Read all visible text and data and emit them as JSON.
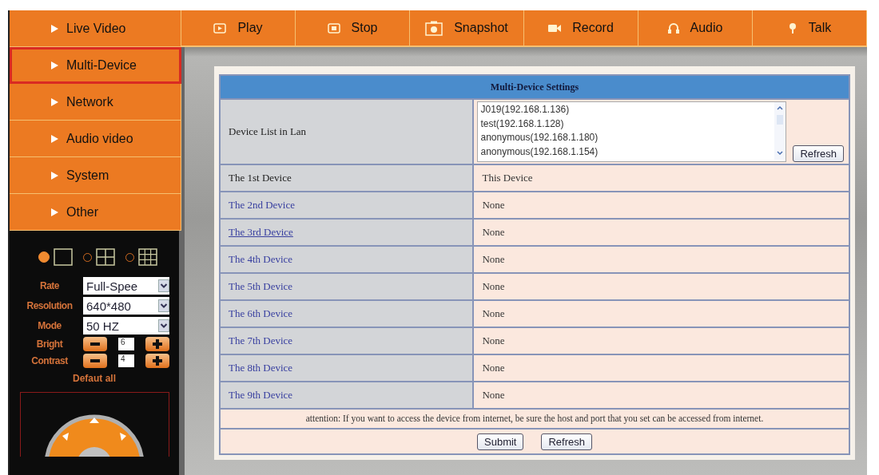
{
  "menu": [
    {
      "label": "Live Video",
      "selected": false
    },
    {
      "label": "Multi-Device",
      "selected": true
    },
    {
      "label": "Network",
      "selected": false
    },
    {
      "label": "Audio video",
      "selected": false
    },
    {
      "label": "System",
      "selected": false
    },
    {
      "label": "Other",
      "selected": false
    }
  ],
  "toolbar": [
    {
      "label": "Play",
      "kind": "play"
    },
    {
      "label": "Stop",
      "kind": "stop"
    },
    {
      "label": "Snapshot",
      "kind": "camera"
    },
    {
      "label": "Record",
      "kind": "video"
    },
    {
      "label": "Audio",
      "kind": "headphones"
    },
    {
      "label": "Talk",
      "kind": "mic"
    }
  ],
  "view_modes": [
    {
      "kind": "single",
      "selected": true
    },
    {
      "kind": "quad",
      "selected": false
    },
    {
      "kind": "nine",
      "selected": false
    }
  ],
  "settings": [
    {
      "kind": "select",
      "label": "Rate",
      "value": "Full-Spee"
    },
    {
      "kind": "select",
      "label": "Resolution",
      "value": "640*480"
    },
    {
      "kind": "select",
      "label": "Mode",
      "value": "50 HZ"
    },
    {
      "kind": "stepper",
      "label": "Bright",
      "value": "6"
    },
    {
      "kind": "stepper",
      "label": "Contrast",
      "value": "4"
    }
  ],
  "default_all": "Defaut all",
  "panel": {
    "title": "Multi-Device Settings",
    "device_list_label": "Device List in Lan",
    "device_list": [
      "J019(192.168.1.136)",
      "test(192.168.1.128)",
      "anonymous(192.168.1.180)",
      "anonymous(192.168.1.154)"
    ],
    "list_refresh": "Refresh",
    "devices": [
      {
        "name": "The 1st Device",
        "value": "This Device",
        "link": false,
        "underlined": false
      },
      {
        "name": "The 2nd Device",
        "value": "None",
        "link": true,
        "underlined": false
      },
      {
        "name": "The 3rd Device",
        "value": "None",
        "link": true,
        "underlined": true
      },
      {
        "name": "The 4th Device",
        "value": "None",
        "link": true,
        "underlined": false
      },
      {
        "name": "The 5th Device",
        "value": "None",
        "link": true,
        "underlined": false
      },
      {
        "name": "The 6th Device",
        "value": "None",
        "link": true,
        "underlined": false
      },
      {
        "name": "The 7th Device",
        "value": "None",
        "link": true,
        "underlined": false
      },
      {
        "name": "The 8th Device",
        "value": "None",
        "link": true,
        "underlined": false
      },
      {
        "name": "The 9th Device",
        "value": "None",
        "link": true,
        "underlined": false
      }
    ],
    "attention": "attention: If you want to access the device from internet, be sure the host and port that you set can be accessed from internet.",
    "buttons": [
      "Submit",
      "Refresh"
    ]
  }
}
